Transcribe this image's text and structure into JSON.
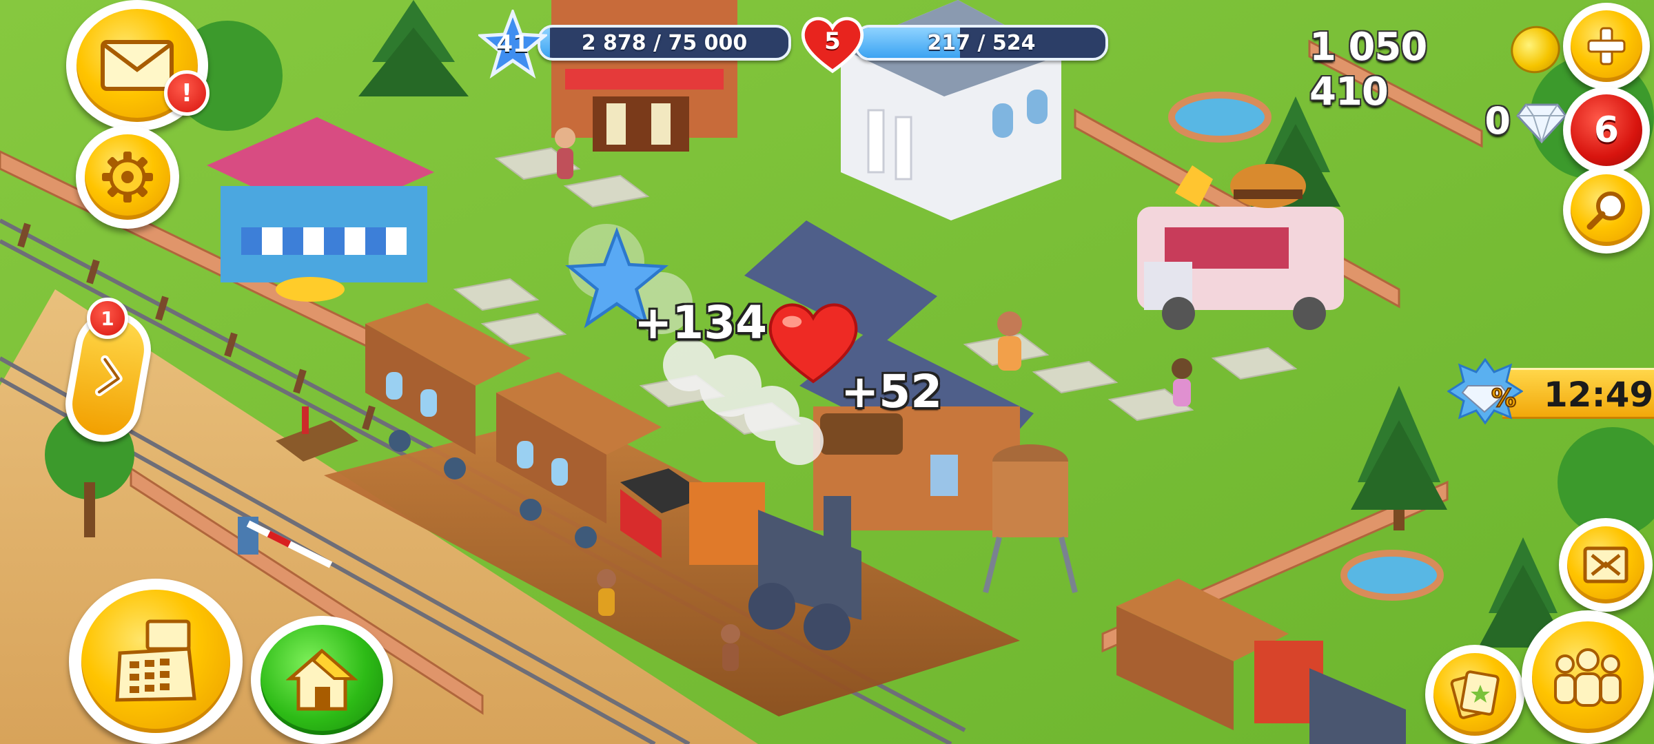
{
  "hud": {
    "level": "41",
    "xp_text": "2 878 / 75 000",
    "xp_progress": 0.038,
    "hearts": "5",
    "hearts_text": "217 / 524",
    "hearts_progress": 0.414,
    "coins": "1 050 410",
    "diamonds": "0",
    "shop_badge": "6",
    "mail_alert": "!",
    "side_panel_badge": "1"
  },
  "popups": {
    "xp_gain": "+134",
    "heart_gain": "+52"
  },
  "offer": {
    "timer": "12:49"
  },
  "icons": {
    "mail": "mail-icon",
    "settings": "gear-icon",
    "expand": "chevron-right-icon",
    "cash_register": "cash-register-icon",
    "home": "home-icon",
    "add_coins": "plus-icon",
    "search": "magnifier-icon",
    "fullscreen": "expand-arrows-icon",
    "friends": "people-icon",
    "album": "cards-icon"
  },
  "colors": {
    "grass": "#7cc23a",
    "gold_button": "#ffc400",
    "green_button": "#2dbb16",
    "xp_bar": "#3ba3f2",
    "red_badge": "#d8140e"
  }
}
